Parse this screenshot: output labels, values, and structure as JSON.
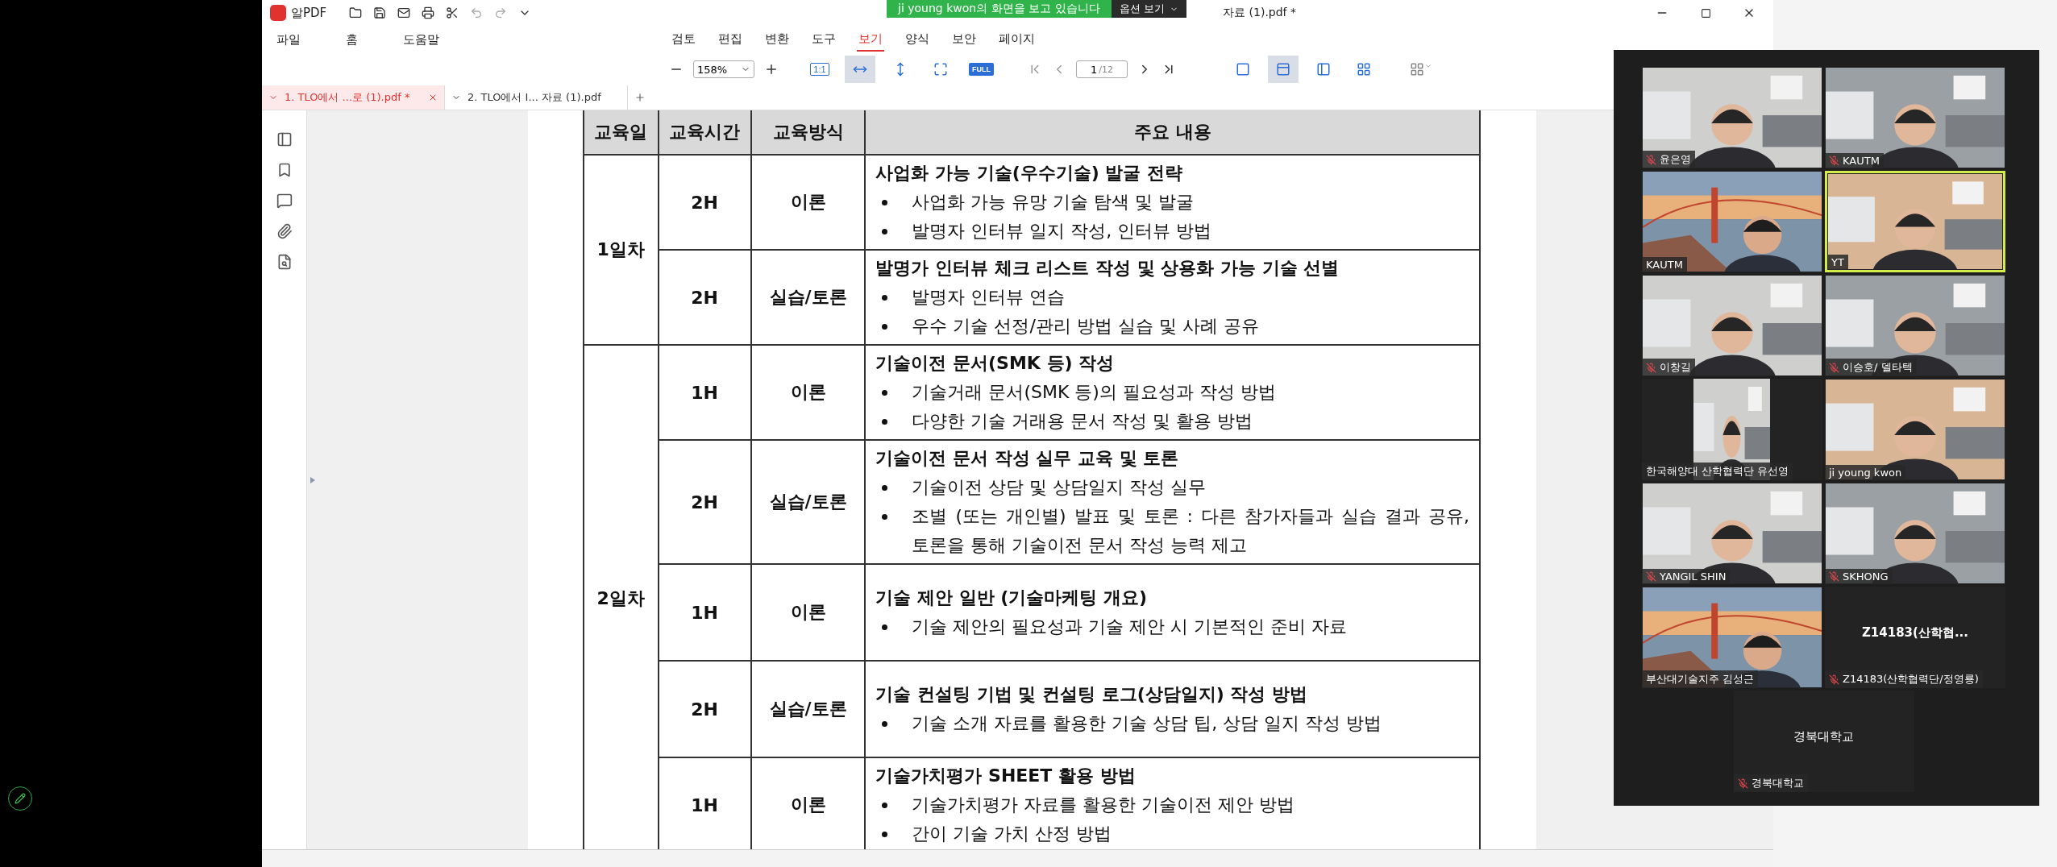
{
  "window": {
    "app_name": "알PDF",
    "title": "자료 (1).pdf *"
  },
  "share_banner": {
    "text": "ji young kwon의 화면을 보고 있습니다",
    "options": "옵션 보기"
  },
  "menu": [
    {
      "label": "파일"
    },
    {
      "label": "홈"
    },
    {
      "label": "도움말"
    }
  ],
  "ribbon_tabs": [
    {
      "label": "검토",
      "selected": false
    },
    {
      "label": "편집",
      "selected": false
    },
    {
      "label": "변환",
      "selected": false
    },
    {
      "label": "도구",
      "selected": false
    },
    {
      "label": "보기",
      "selected": true
    },
    {
      "label": "양식",
      "selected": false
    },
    {
      "label": "보안",
      "selected": false
    },
    {
      "label": "페이지",
      "selected": false
    }
  ],
  "toolbar": {
    "zoom": "158%",
    "page": "1",
    "page_total": "/12",
    "fit_buttons": [
      {
        "kind": "outlined",
        "label": "1:1",
        "selected": false
      },
      {
        "kind": "fit-width",
        "selected": true
      },
      {
        "kind": "fit-height",
        "selected": false
      },
      {
        "kind": "fit-page",
        "selected": false
      },
      {
        "kind": "filled",
        "label": "FULL",
        "selected": false
      }
    ],
    "view_modes": [
      {
        "kind": "single",
        "selected": false
      },
      {
        "kind": "continuous",
        "selected": true
      },
      {
        "kind": "two-page",
        "selected": false
      },
      {
        "kind": "grid",
        "selected": false
      }
    ]
  },
  "doc_tabs": [
    {
      "label": "1. TLO에서 ...로 (1).pdf *",
      "selected": true
    },
    {
      "label": "2. TLO에서 I... 자료 (1).pdf",
      "selected": false
    }
  ],
  "table": {
    "columns": [
      "교육일",
      "교육시간",
      "교육방식",
      "주요 내용"
    ],
    "groups": [
      {
        "day": "1일차",
        "sessions": [
          {
            "hours": "2H",
            "method": "이론",
            "title": "사업화 가능 기술(우수기술) 발굴 전략",
            "bullets": [
              "사업화 가능 유망 기술 탐색 및 발굴",
              "발명자 인터뷰 일지 작성, 인터뷰 방법"
            ]
          },
          {
            "hours": "2H",
            "method": "실습/토론",
            "title": "발명가 인터뷰 체크 리스트 작성 및 상용화 가능 기술 선별",
            "bullets": [
              "발명자 인터뷰 연습",
              "우수 기술 선정/관리 방법 실습 및 사례 공유"
            ]
          }
        ]
      },
      {
        "day": "2일차",
        "sessions": [
          {
            "hours": "1H",
            "method": "이론",
            "title": "기술이전 문서(SMK 등) 작성",
            "bullets": [
              "기술거래 문서(SMK 등)의 필요성과 작성 방법",
              "다양한 기술 거래용 문서 작성 및 활용 방법"
            ]
          },
          {
            "hours": "2H",
            "method": "실습/토론",
            "title": "기술이전 문서 작성 실무 교육 및 토론",
            "bullets": [
              "기술이전 상담 및 상담일지 작성 실무",
              "조별 (또는 개인별) 발표 및 토론 : 다른 참가자들과 실습 결과 공유, 토론을 통해 기술이전 문서 작성 능력 제고"
            ]
          },
          {
            "hours": "1H",
            "method": "이론",
            "title": "기술 제안 일반 (기술마케팅 개요)",
            "bullets": [
              "기술 제안의 필요성과 기술 제안 시 기본적인 준비 자료"
            ]
          },
          {
            "hours": "2H",
            "method": "실습/토론",
            "title": "기술 컨설팅 기법 및 컨설팅 로그(상담일지) 작성 방법",
            "bullets": [
              "기술 소개 자료를 활용한 기술 상담 팁, 상담 일지 작성 방법"
            ]
          },
          {
            "hours": "1H",
            "method": "이론",
            "title": "기술가치평가 SHEET 활용 방법",
            "bullets": [
              "기술가치평가 자료를 활용한 기술이전 제안 방법",
              "간이 기술 가치 산정 방법"
            ]
          }
        ]
      }
    ]
  },
  "participants": [
    {
      "name": "윤은영",
      "kind": "picture",
      "muted": true,
      "active": false
    },
    {
      "name": "KAUTM",
      "kind": "picture",
      "muted": true,
      "active": false
    },
    {
      "name": "KAUTM",
      "kind": "picture",
      "muted": false,
      "active": false
    },
    {
      "name": "YT",
      "kind": "picture",
      "muted": false,
      "active": true
    },
    {
      "name": "이창길",
      "kind": "picture",
      "muted": true,
      "active": false
    },
    {
      "name": "이승호/ 델타텍",
      "kind": "picture",
      "muted": true,
      "active": false
    },
    {
      "name": "한국해양대 산학협력단 유선영",
      "kind": "portrait",
      "muted": false,
      "active": false
    },
    {
      "name": "ji young kwon",
      "kind": "picture",
      "muted": false,
      "active": false
    },
    {
      "name": "YANGIL SHIN",
      "kind": "picture",
      "muted": true,
      "active": false
    },
    {
      "name": "SKHONG",
      "kind": "picture",
      "muted": true,
      "active": false
    },
    {
      "name": "부산대기술지주 김성근",
      "kind": "picture",
      "muted": false,
      "active": false
    },
    {
      "name": "Z14183(산학협력단/정영룡)",
      "kind": "none",
      "display": "Z14183(산학협...",
      "bold": true,
      "muted": true,
      "active": false
    },
    {
      "name": "경북대학교",
      "kind": "none",
      "display": "경북대학교",
      "bold": false,
      "muted": true,
      "active": false
    }
  ]
}
